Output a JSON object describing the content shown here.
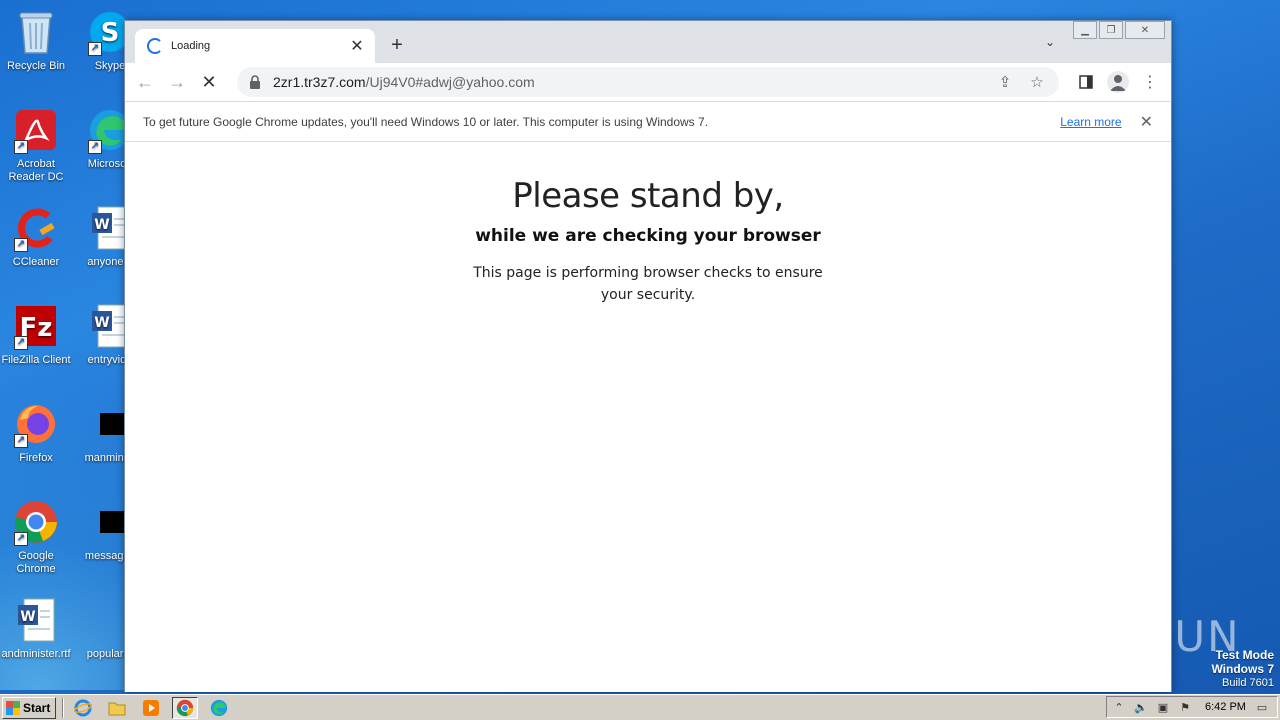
{
  "desktop": {
    "icons": [
      {
        "label": "Recycle Bin"
      },
      {
        "label": "Skype"
      },
      {
        "label": "Acrobat Reader DC"
      },
      {
        "label": "Microsoft"
      },
      {
        "label": "CCleaner"
      },
      {
        "label": "anyonem"
      },
      {
        "label": "FileZilla Client"
      },
      {
        "label": "entryvide"
      },
      {
        "label": "Firefox"
      },
      {
        "label": "manminim"
      },
      {
        "label": "Google Chrome"
      },
      {
        "label": "messages"
      },
      {
        "label": "andminister.rtf"
      },
      {
        "label": "popularre"
      }
    ]
  },
  "browser": {
    "tab_title": "Loading",
    "url_host": "2zr1.tr3z7.com",
    "url_path": "/Uj94V0#adwj@yahoo.com",
    "infobar": {
      "text": "To get future Google Chrome updates, you'll need Windows 10 or later. This computer is using Windows 7.",
      "link": "Learn more"
    }
  },
  "page": {
    "heading": "Please stand by,",
    "subheading": "while we are checking your browser",
    "body": "This page is performing browser checks to ensure your security."
  },
  "watermark": "ANY RUN",
  "test_mode": {
    "line1": "Test Mode",
    "line2": "Windows 7",
    "line3": "Build 7601"
  },
  "taskbar": {
    "start_label": "Start",
    "clock": "6:42 PM"
  },
  "colors": {
    "accent": "#1a73e8",
    "desktop": "#1e6cc8"
  }
}
